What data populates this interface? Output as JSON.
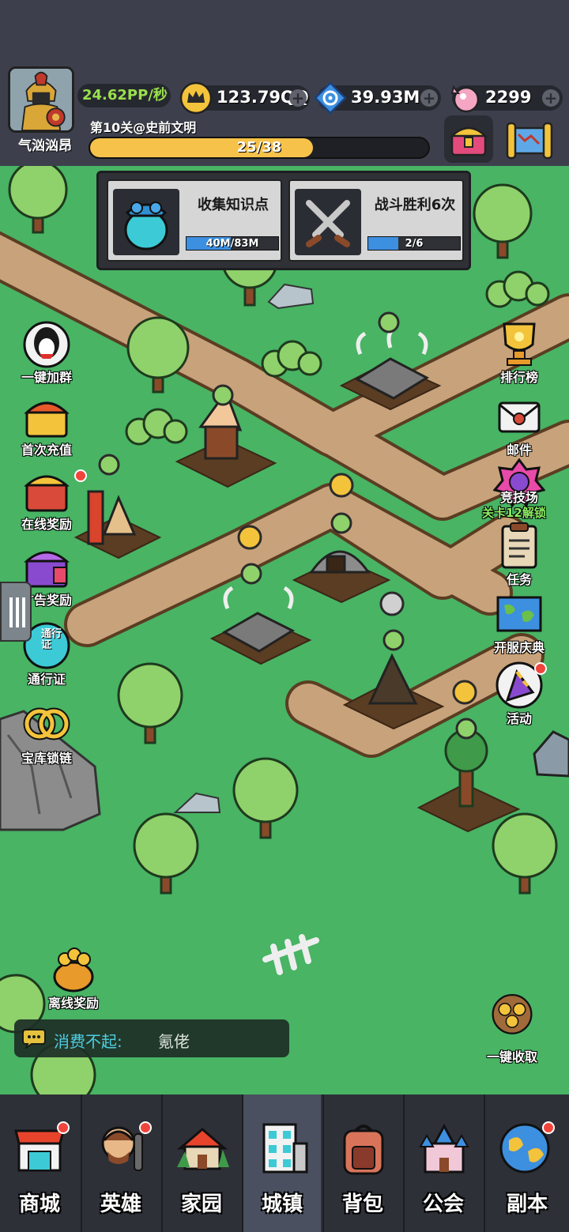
{
  "player": {
    "name": "气汹汹昂",
    "pps": "24.62PP/秒"
  },
  "resources": [
    {
      "name": "crown-coins",
      "value": "123.79QQ"
    },
    {
      "name": "blue-gems",
      "value": "39.93M"
    },
    {
      "name": "candy",
      "value": "2299"
    }
  ],
  "level": {
    "label": "第10关@史前文明",
    "progress_text": "25/38",
    "current": 25,
    "total": 38
  },
  "quests": [
    {
      "title": "收集知识点",
      "progress_text": "40M/83M",
      "fraction": 0.48
    },
    {
      "title": "战斗胜利6次",
      "progress_text": "2/6",
      "fraction": 0.33
    }
  ],
  "left_buttons": [
    {
      "label": "一键加群"
    },
    {
      "label": "首次充值"
    },
    {
      "label": "在线奖励"
    },
    {
      "label": "广告奖励"
    },
    {
      "label": "通行证"
    },
    {
      "label": "宝库锁链"
    },
    {
      "label": "离线奖励"
    }
  ],
  "right_buttons": [
    {
      "label": "排行榜"
    },
    {
      "label": "邮件"
    },
    {
      "label": "竞技场"
    },
    {
      "label": "任务"
    },
    {
      "label": "开服庆典"
    },
    {
      "label": "活动"
    },
    {
      "label": "一键收取"
    }
  ],
  "arena_lock": "关卡12解锁",
  "pass_icon_text": "通行证",
  "chat": {
    "name": "消费不起:",
    "message": "氪佬"
  },
  "nav_tabs": [
    {
      "label": "商城",
      "icon": "shop-icon",
      "badge": true
    },
    {
      "label": "英雄",
      "icon": "hero-icon",
      "badge": true
    },
    {
      "label": "家园",
      "icon": "home-icon",
      "badge": false
    },
    {
      "label": "城镇",
      "icon": "town-icon",
      "badge": false,
      "active": true
    },
    {
      "label": "背包",
      "icon": "backpack-icon",
      "badge": false
    },
    {
      "label": "公会",
      "icon": "castle-icon",
      "badge": false
    },
    {
      "label": "副本",
      "icon": "globe-icon",
      "badge": true
    }
  ]
}
